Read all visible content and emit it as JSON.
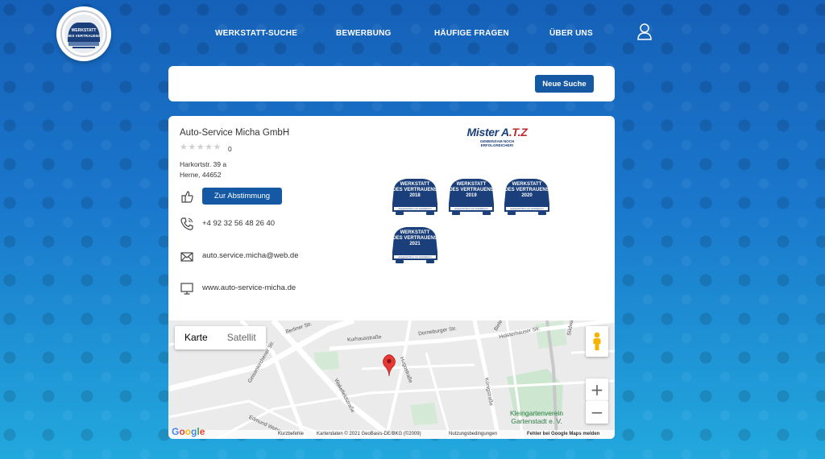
{
  "logo": {
    "line1": "WERKSTATT",
    "line2": "DES VERTRAUENS"
  },
  "nav": {
    "items": [
      {
        "label": "WERKSTATT-SUCHE"
      },
      {
        "label": "BEWERBUNG"
      },
      {
        "label": "HÄUFIGE FRAGEN"
      },
      {
        "label": "ÜBER UNS"
      }
    ]
  },
  "search": {
    "new_search_label": "Neue Suche"
  },
  "business": {
    "name": "Auto-Service Micha GmbH",
    "stars": "★★★★★",
    "rating_count": "0",
    "street": "Harkortstr. 39 a",
    "city": "Herne, 44652",
    "vote_label": "Zur Abstimmung",
    "phone": "+4 92 32 56 48 26 40",
    "email": "auto.service.micha@web.de",
    "website": "www.auto-service-micha.de"
  },
  "partner": {
    "name_main": "Mister A",
    "name_accent": ".T.Z",
    "slogan": "GEMEINSAM NOCH ERFOLGREICHER!"
  },
  "badges": [
    {
      "line1": "WERKSTATT",
      "line2": "DES VERTRAUENS",
      "year": "2018",
      "sub": "ausgezeichnet von Autofahrern"
    },
    {
      "line1": "WERKSTATT",
      "line2": "DES VERTRAUENS",
      "year": "2019",
      "sub": "ausgezeichnet von Autofahrern"
    },
    {
      "line1": "WERKSTATT",
      "line2": "DES VERTRAUENS",
      "year": "2020",
      "sub": "ausgezeichnet von Autofahrern"
    },
    {
      "line1": "WERKSTATT",
      "line2": "DES VERTRAUENS",
      "year": "2021",
      "sub": "ausgezeichnet von Autofahrern"
    }
  ],
  "map": {
    "tab_map": "Karte",
    "tab_satellite": "Satellit",
    "zoom_in": "+",
    "zoom_out": "−",
    "streets": {
      "berliner": "Berliner Str.",
      "kurhaus": "Kurhausstraße",
      "dorneburger": "Dorneburger Str.",
      "holsterhauser": "Holsterhauser Str.",
      "bielef": "Bielef",
      "geisen": "Geisenkirchener Str.",
      "hugo": "Hugostraße",
      "koenig": "Königstraße",
      "wakefield": "Wakefieldstraße",
      "edmund": "Edmund Weber",
      "sudwall": "Südwall"
    },
    "poi": "Kleingartenverein\nGartenstadt e. V.",
    "google": "Google",
    "shortcuts": "Kurzbefehle",
    "attribution": "Kartendaten © 2021 GeoBasis-DE/BKG (©2009)",
    "terms": "Nutzungsbedingungen",
    "report": "Fehler bei Google Maps melden"
  },
  "colors": {
    "brand": "#1559a4",
    "marker": "#e53935"
  }
}
